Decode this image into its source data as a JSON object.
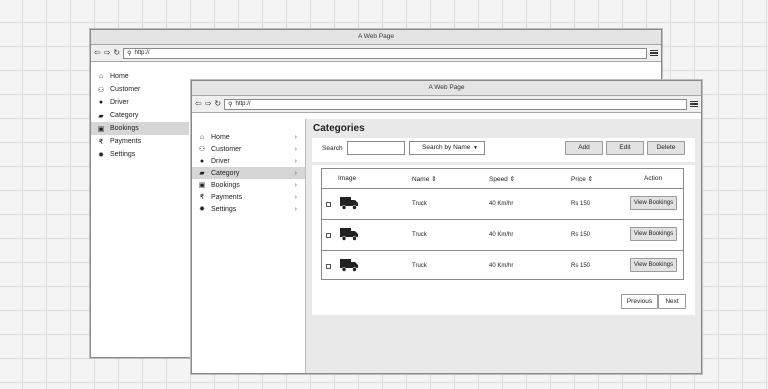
{
  "back_window": {
    "title": "A Web Page",
    "url": "http://",
    "sidebar": [
      {
        "label": "Home",
        "icon": "home-icon",
        "glyph": "⌂"
      },
      {
        "label": "Customer",
        "icon": "users-icon",
        "glyph": "⚇"
      },
      {
        "label": "Driver",
        "icon": "user-icon",
        "glyph": "●"
      },
      {
        "label": "Category",
        "icon": "category-icon",
        "glyph": "▰"
      },
      {
        "label": "Bookings",
        "icon": "bookings-icon",
        "glyph": "▣"
      },
      {
        "label": "Payments",
        "icon": "rupee-icon",
        "glyph": "₹"
      },
      {
        "label": "Settings",
        "icon": "gear-icon",
        "glyph": "✹"
      }
    ]
  },
  "front_window": {
    "title": "A Web Page",
    "url": "http://",
    "sidebar": [
      {
        "label": "Home",
        "glyph": "⌂"
      },
      {
        "label": "Customer",
        "glyph": "⚇"
      },
      {
        "label": "Driver",
        "glyph": "●"
      },
      {
        "label": "Category",
        "glyph": "▰"
      },
      {
        "label": "Bookings",
        "glyph": "▣"
      },
      {
        "label": "Payments",
        "glyph": "₹"
      },
      {
        "label": "Settings",
        "glyph": "✹"
      }
    ],
    "page_title": "Categories",
    "search_label": "Search",
    "search_by": "Search by Name",
    "buttons": {
      "add": "Add",
      "edit": "Edit",
      "delete": "Delete"
    },
    "table": {
      "headers": {
        "image": "Image",
        "name": "Name ⇕",
        "speed": "Speed ⇕",
        "price": "Price ⇕",
        "action": "Action"
      },
      "rows": [
        {
          "name": "Truck",
          "speed": "40 Km/hr",
          "price": "Rs 150",
          "action": "View Bookings"
        },
        {
          "name": "Truck",
          "speed": "40 Km/hr",
          "price": "Rs 150",
          "action": "View Bookings"
        },
        {
          "name": "Truck",
          "speed": "40 Km/hr",
          "price": "Rs 150",
          "action": "View Bookings"
        }
      ]
    },
    "pagination": {
      "previous": "Previous",
      "next": "Next"
    }
  }
}
